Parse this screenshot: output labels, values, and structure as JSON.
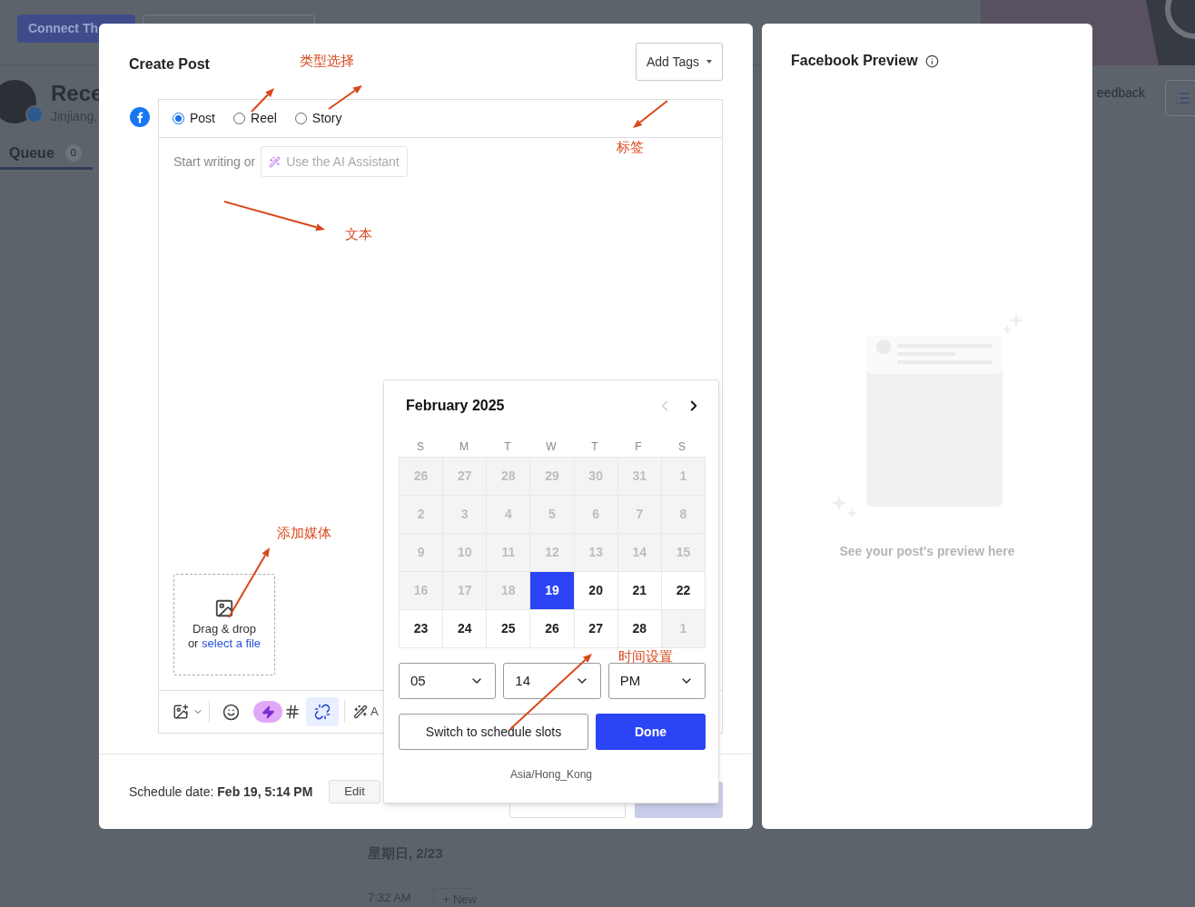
{
  "background": {
    "connect_button": "Connect Th",
    "profile_title": "Rece",
    "profile_subtitle": "Jinjiang,",
    "tabs": [
      {
        "label": "Queue",
        "count": "0",
        "selected": true
      }
    ],
    "feedback": "eedback",
    "day_heading": "星期日, 2/23",
    "slot_time": "7:32 AM",
    "new_button": "+ New"
  },
  "modal": {
    "title": "Create Post",
    "add_tags": "Add Tags",
    "post_types": [
      {
        "label": "Post",
        "selected": true
      },
      {
        "label": "Reel",
        "selected": false
      },
      {
        "label": "Story",
        "selected": false
      }
    ],
    "prompt": "Start writing or",
    "ai_button": "Use the AI Assistant",
    "media_drop": {
      "text": "Drag & drop",
      "prefix": "or",
      "link": "select a file"
    },
    "toolbar_cut_text": "A",
    "schedule": "Schedule date: **Feb 19, 5:14 PM**",
    "edit_button": "Edit"
  },
  "calendar": {
    "month": "February 2025",
    "weekdays": [
      "S",
      "M",
      "T",
      "W",
      "T",
      "F",
      "S"
    ],
    "weeks": [
      [
        {
          "day": "26",
          "disabled": true,
          "selected": false
        },
        {
          "day": "27",
          "disabled": true,
          "selected": false
        },
        {
          "day": "28",
          "disabled": true,
          "selected": false
        },
        {
          "day": "29",
          "disabled": true,
          "selected": false
        },
        {
          "day": "30",
          "disabled": true,
          "selected": false
        },
        {
          "day": "31",
          "disabled": true,
          "selected": false
        },
        {
          "day": "1",
          "disabled": true,
          "selected": false
        }
      ],
      [
        {
          "day": "2",
          "disabled": true,
          "selected": false
        },
        {
          "day": "3",
          "disabled": true,
          "selected": false
        },
        {
          "day": "4",
          "disabled": true,
          "selected": false
        },
        {
          "day": "5",
          "disabled": true,
          "selected": false
        },
        {
          "day": "6",
          "disabled": true,
          "selected": false
        },
        {
          "day": "7",
          "disabled": true,
          "selected": false
        },
        {
          "day": "8",
          "disabled": true,
          "selected": false
        }
      ],
      [
        {
          "day": "9",
          "disabled": true,
          "selected": false
        },
        {
          "day": "10",
          "disabled": true,
          "selected": false
        },
        {
          "day": "11",
          "disabled": true,
          "selected": false
        },
        {
          "day": "12",
          "disabled": true,
          "selected": false
        },
        {
          "day": "13",
          "disabled": true,
          "selected": false
        },
        {
          "day": "14",
          "disabled": true,
          "selected": false
        },
        {
          "day": "15",
          "disabled": true,
          "selected": false
        }
      ],
      [
        {
          "day": "16",
          "disabled": true,
          "selected": false
        },
        {
          "day": "17",
          "disabled": true,
          "selected": false
        },
        {
          "day": "18",
          "disabled": true,
          "selected": false
        },
        {
          "day": "19",
          "disabled": false,
          "selected": true
        },
        {
          "day": "20",
          "disabled": false,
          "selected": false
        },
        {
          "day": "21",
          "disabled": false,
          "selected": false
        },
        {
          "day": "22",
          "disabled": false,
          "selected": false
        }
      ],
      [
        {
          "day": "23",
          "disabled": false,
          "selected": false
        },
        {
          "day": "24",
          "disabled": false,
          "selected": false
        },
        {
          "day": "25",
          "disabled": false,
          "selected": false
        },
        {
          "day": "26",
          "disabled": false,
          "selected": false
        },
        {
          "day": "27",
          "disabled": false,
          "selected": false
        },
        {
          "day": "28",
          "disabled": false,
          "selected": false
        },
        {
          "day": "1",
          "disabled": true,
          "selected": false
        }
      ]
    ],
    "hour": "05",
    "minute": "14",
    "period": "PM",
    "switch_button": "Switch to schedule slots",
    "done_button": "Done",
    "timezone": "Asia/Hong_Kong"
  },
  "preview": {
    "title": "Facebook Preview",
    "empty_text": "See your post's preview here"
  },
  "annotations": [
    "类型选择",
    "标签",
    "文本",
    "添加媒体",
    "时间设置"
  ]
}
